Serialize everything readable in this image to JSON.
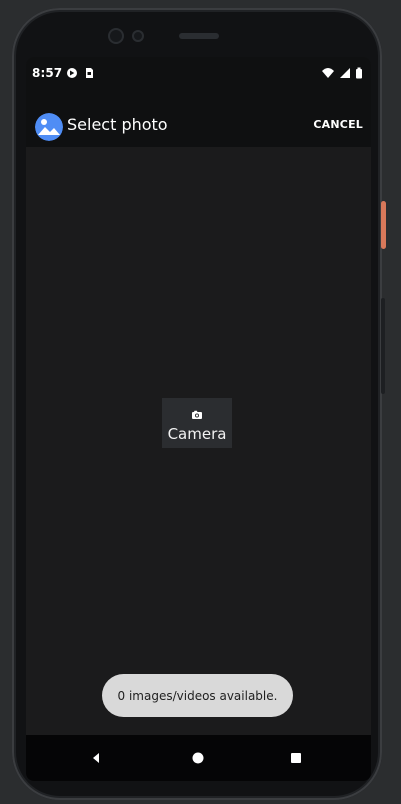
{
  "status_bar": {
    "time": "8:57",
    "left_icons": [
      "play-store-icon",
      "sim-card-icon"
    ],
    "right_icons": [
      "wifi-icon",
      "signal-icon",
      "battery-icon"
    ]
  },
  "app_bar": {
    "logo_icon": "photo-logo-icon",
    "title": "Select photo",
    "cancel_label": "CANCEL"
  },
  "main": {
    "camera_card": {
      "icon": "camera-icon",
      "label": "Camera"
    }
  },
  "toast": {
    "message": "0 images/videos available."
  },
  "navigation": {
    "back_icon": "back-icon",
    "home_icon": "home-icon",
    "recents_icon": "recents-icon"
  },
  "colors": {
    "background": "#1b1b1c",
    "toolbar": "#0f1011",
    "toast": "#d9d9d9",
    "accent_blue": "#4f8df5",
    "side_button": "#d8785a"
  }
}
